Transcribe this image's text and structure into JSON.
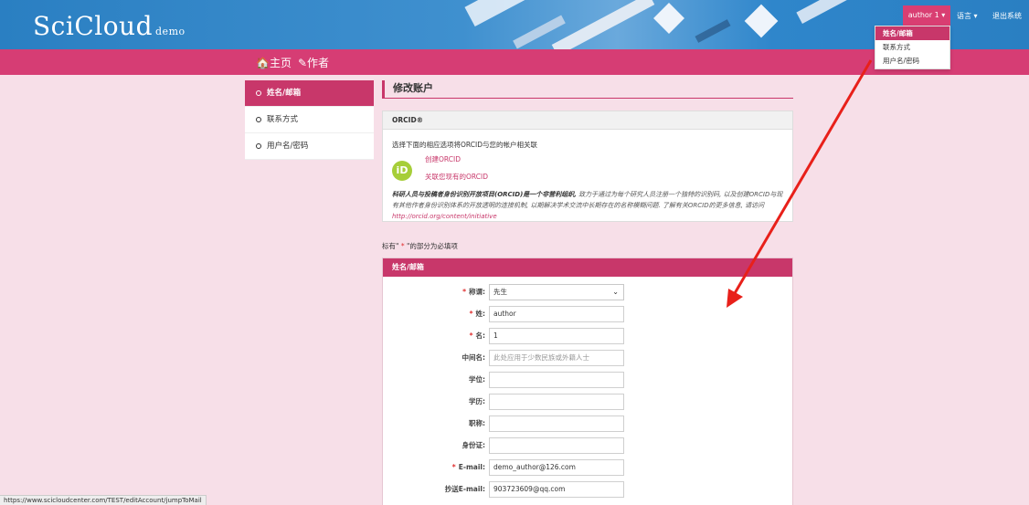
{
  "header": {
    "logo": "SciCloud",
    "logo_suffix": "demo",
    "user_menu": "author 1 ▾",
    "language": "语言 ▾",
    "logout": "退出系统",
    "dropdown": [
      "姓名/邮箱",
      "联系方式",
      "用户名/密码"
    ]
  },
  "nav": {
    "home": "🏠主页",
    "author": "✎作者"
  },
  "sidebar": {
    "items": [
      {
        "label": "姓名/邮箱"
      },
      {
        "label": "联系方式"
      },
      {
        "label": "用户名/密码"
      }
    ]
  },
  "main": {
    "title": "修改账户",
    "orcid": {
      "header": "ORCID®",
      "desc": "选择下面的相应选项将ORCID与您的帐户相关联",
      "logo": "iD",
      "create": "创建ORCID",
      "link": "关联您现有的ORCID",
      "text_bold": "科研人员与投稿者身份识别开放项目(ORCID)是一个非营利组织,",
      "text_rest": " 致力于通过为每个研究人员注册一个独特的识别码, 以及创建ORCID与现有其他作者身份识别体系的开放透明的连接机制, 以期解决学术交流中长期存在的名称模糊问题. 了解有关ORCID的更多信息, 请访问",
      "url": "http://orcid.org/content/initiative"
    },
    "required_note_prefix": "标有\"",
    "required_note_star": " * ",
    "required_note_suffix": "\"的部分为必填项",
    "form": {
      "header": "姓名/邮箱",
      "fields": [
        {
          "label": "称谓:",
          "required": true,
          "value": "先生",
          "type": "select"
        },
        {
          "label": "姓:",
          "required": true,
          "value": "author"
        },
        {
          "label": "名:",
          "required": true,
          "value": "1"
        },
        {
          "label": "中间名:",
          "required": false,
          "value": "",
          "placeholder": "此处应用于少数民族或外籍人士"
        },
        {
          "label": "学位:",
          "required": false,
          "value": ""
        },
        {
          "label": "学历:",
          "required": false,
          "value": ""
        },
        {
          "label": "职称:",
          "required": false,
          "value": ""
        },
        {
          "label": "身份证:",
          "required": false,
          "value": ""
        },
        {
          "label": "E-mail:",
          "required": true,
          "value": "demo_author@126.com"
        },
        {
          "label": "抄送E-mail:",
          "required": false,
          "value": "903723609@qq.com"
        }
      ]
    }
  },
  "status_bar": "https://www.scicloudcenter.com/TEST/editAccount/jumpToMail",
  "colors": {
    "brand": "#c8376a",
    "header_blue": "#2a7fc2",
    "background": "#f7dfe8",
    "arrow": "#e8201a"
  }
}
